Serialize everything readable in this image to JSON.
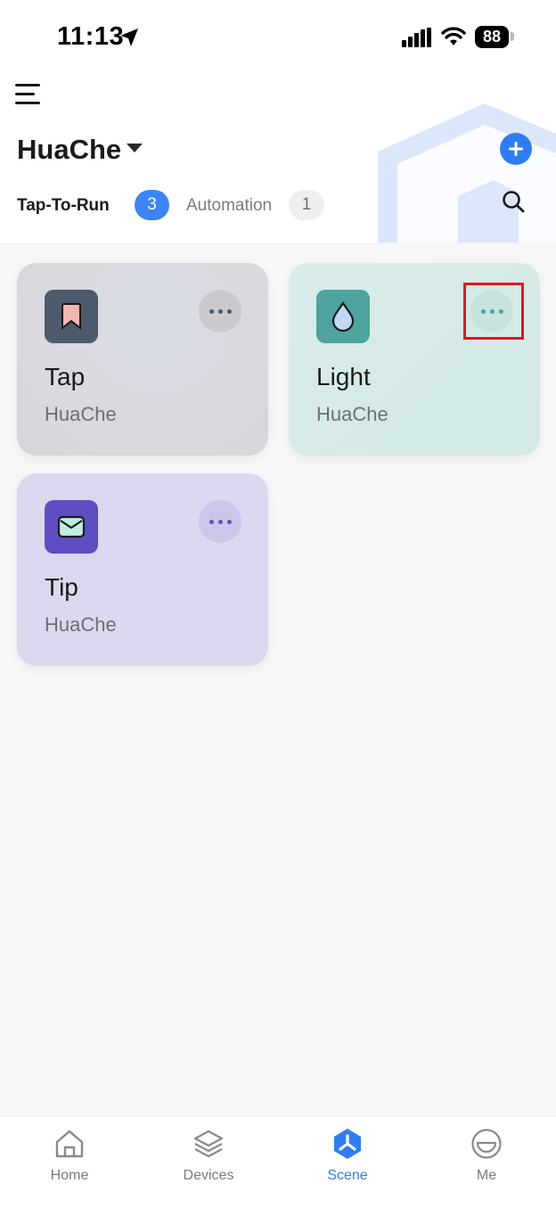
{
  "status_bar": {
    "time": "11:13",
    "battery": "88"
  },
  "header": {
    "home_name": "HuaChe",
    "tabs": [
      {
        "label": "Tap-To-Run",
        "count": "3",
        "active": true
      },
      {
        "label": "Automation",
        "count": "1",
        "active": false
      }
    ]
  },
  "scenes": [
    {
      "name": "Tap",
      "home": "HuaChe",
      "icon": "bookmark-icon",
      "color": "#4d5a6b"
    },
    {
      "name": "Light",
      "home": "HuaChe",
      "icon": "water-drop-icon",
      "color": "#4ea39e"
    },
    {
      "name": "Tip",
      "home": "HuaChe",
      "icon": "mail-icon",
      "color": "#5d4fc2"
    }
  ],
  "bottom_nav": {
    "items": [
      {
        "label": "Home",
        "icon": "home-icon",
        "active": false
      },
      {
        "label": "Devices",
        "icon": "layers-icon",
        "active": false
      },
      {
        "label": "Scene",
        "icon": "scene-icon",
        "active": true
      },
      {
        "label": "Me",
        "icon": "profile-icon",
        "active": false
      }
    ]
  },
  "colors": {
    "accent": "#2f7df6",
    "highlight": "#e8141c"
  }
}
